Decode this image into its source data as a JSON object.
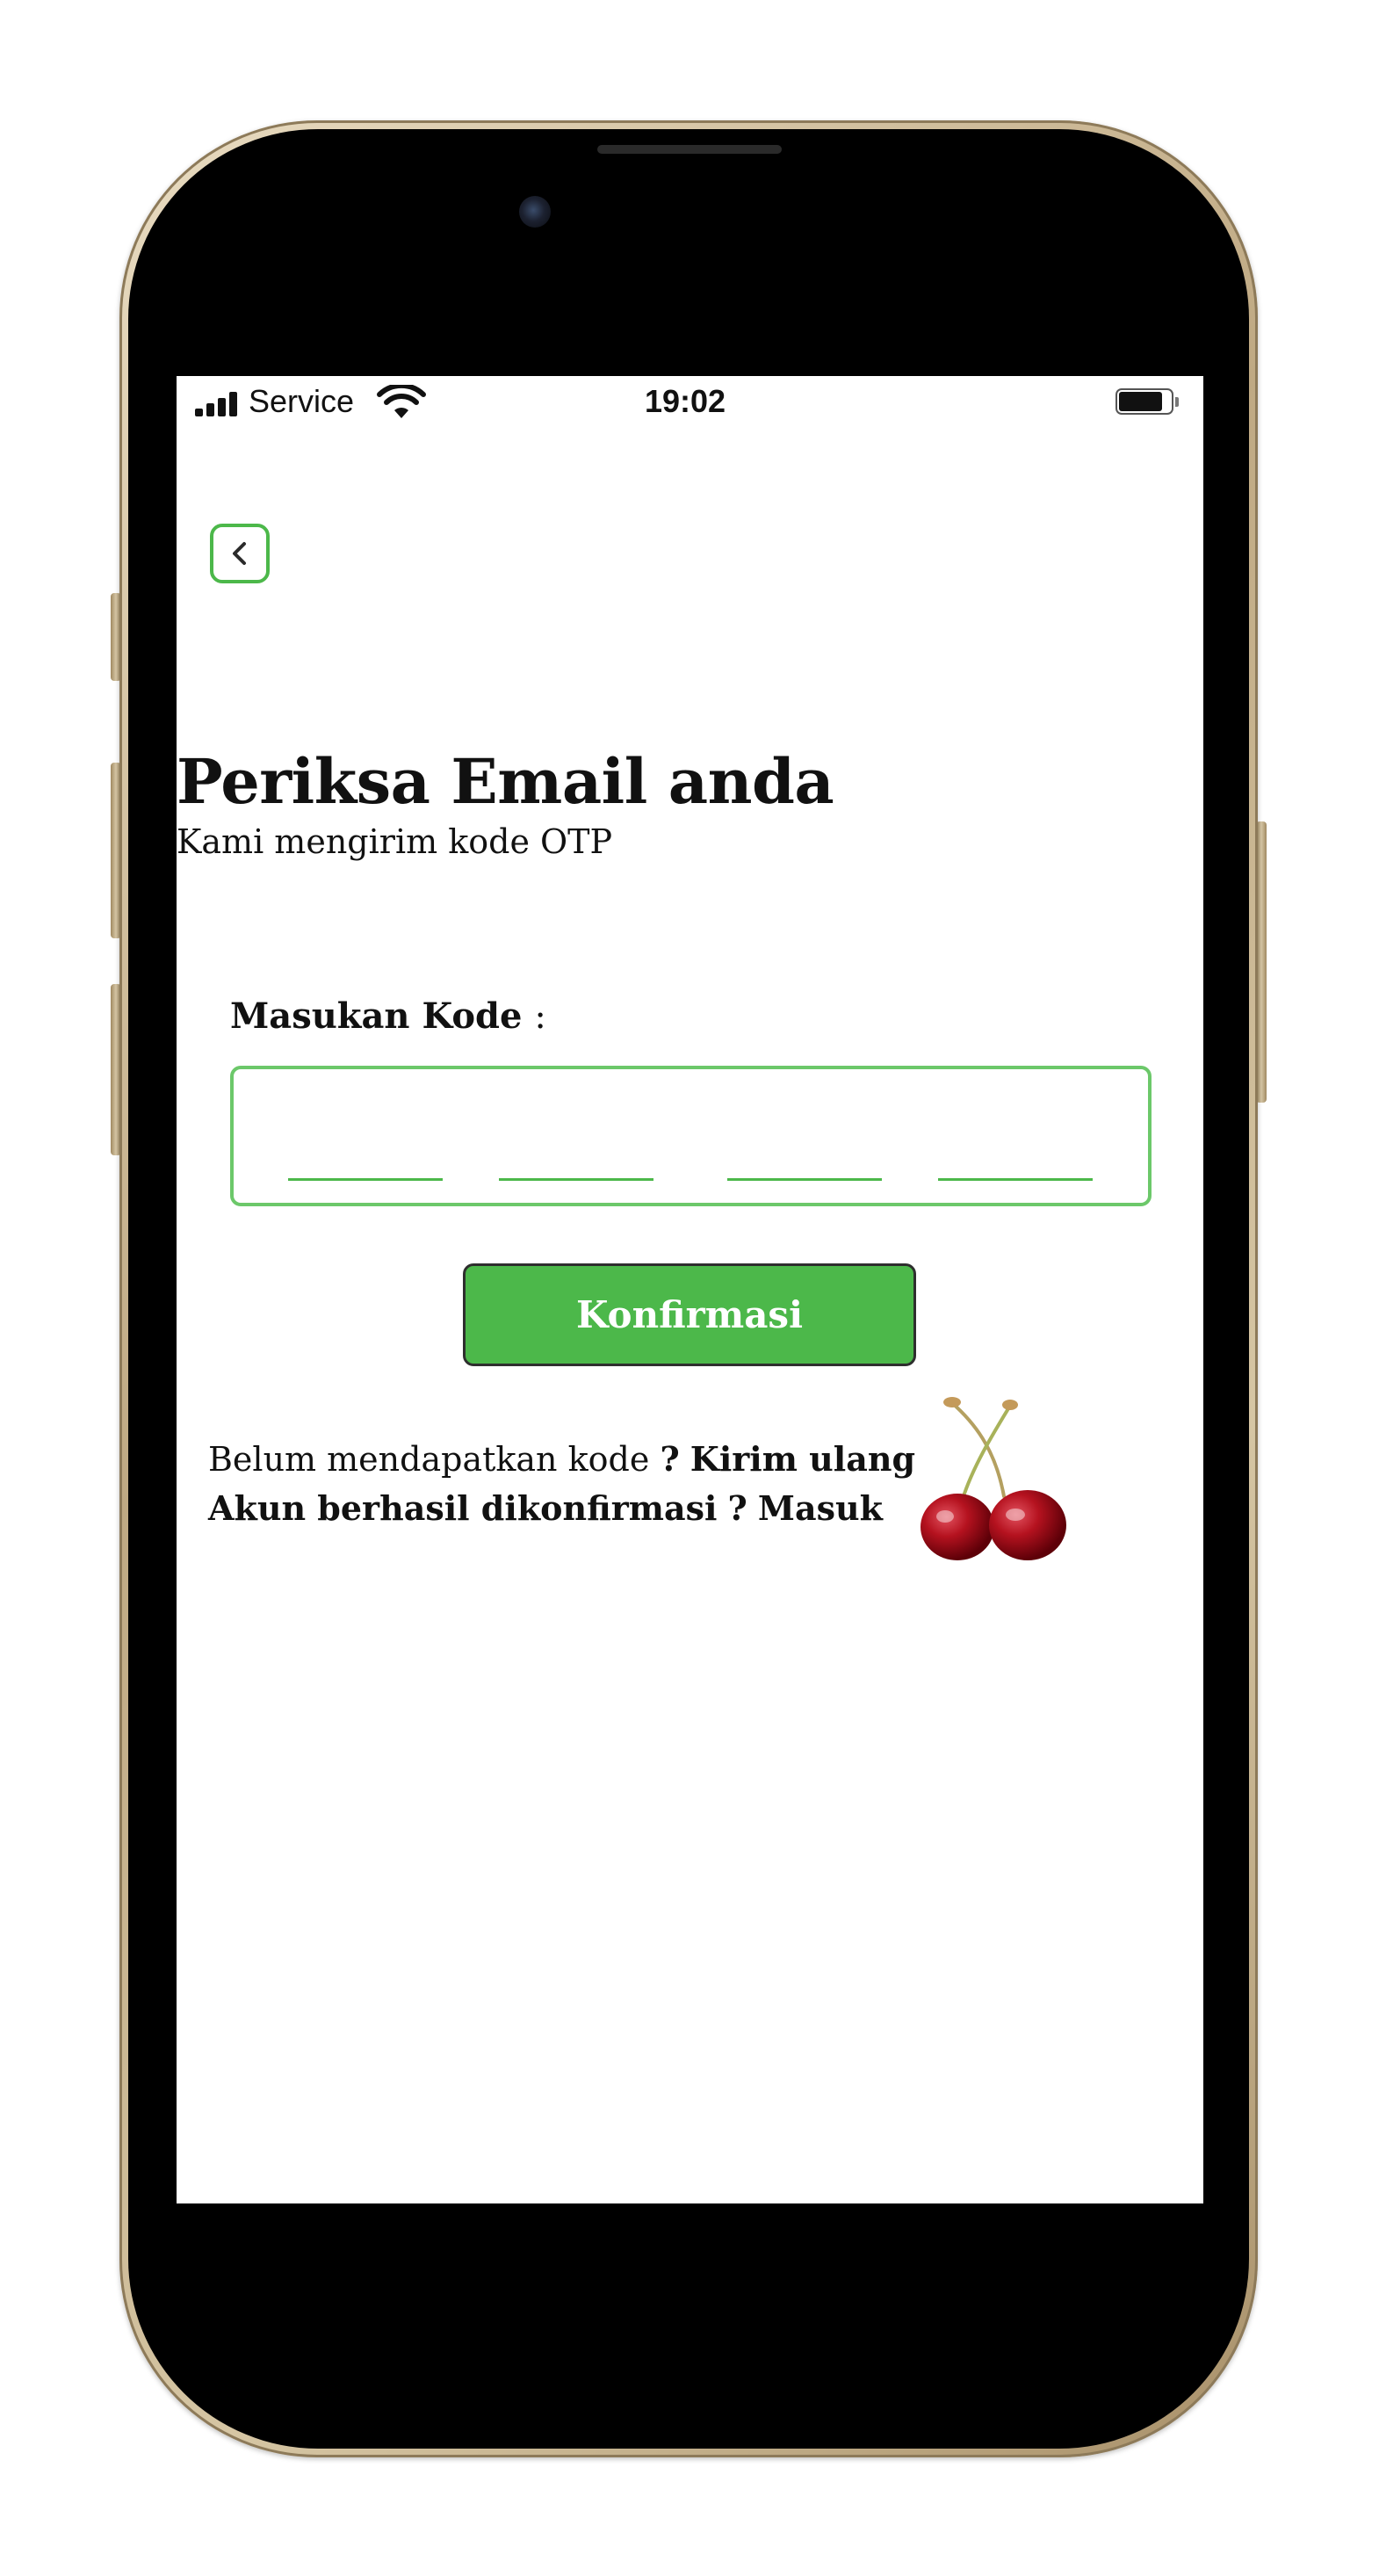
{
  "status_bar": {
    "carrier": "Service",
    "time": "19:02",
    "battery_level": 0.85
  },
  "page": {
    "title": "Periksa Email anda",
    "subtitle": "Kami mengirim kode OTP"
  },
  "form": {
    "code_label": "Masukan Kode",
    "code_label_colon": ":",
    "otp_digits": 4,
    "otp_values": [
      "",
      "",
      "",
      ""
    ],
    "confirm_label": "Konfirmasi"
  },
  "footer": {
    "resend_prompt": "Belum mendapatkan kode",
    "resend_q": "?",
    "resend_link": "Kirim ulang",
    "login_prompt": "Akun berhasil dikonfirmasi",
    "login_q": "?",
    "login_link": "Masuk"
  },
  "colors": {
    "accent": "#4cb84a",
    "otp_border": "#6cc86a",
    "text": "#111111",
    "phone_frame": "#bfa983"
  },
  "icons": {
    "back": "chevron-left-icon",
    "signal": "cellular-signal-icon",
    "wifi": "wifi-icon",
    "battery": "battery-icon",
    "illustration": "cherry-icon"
  }
}
